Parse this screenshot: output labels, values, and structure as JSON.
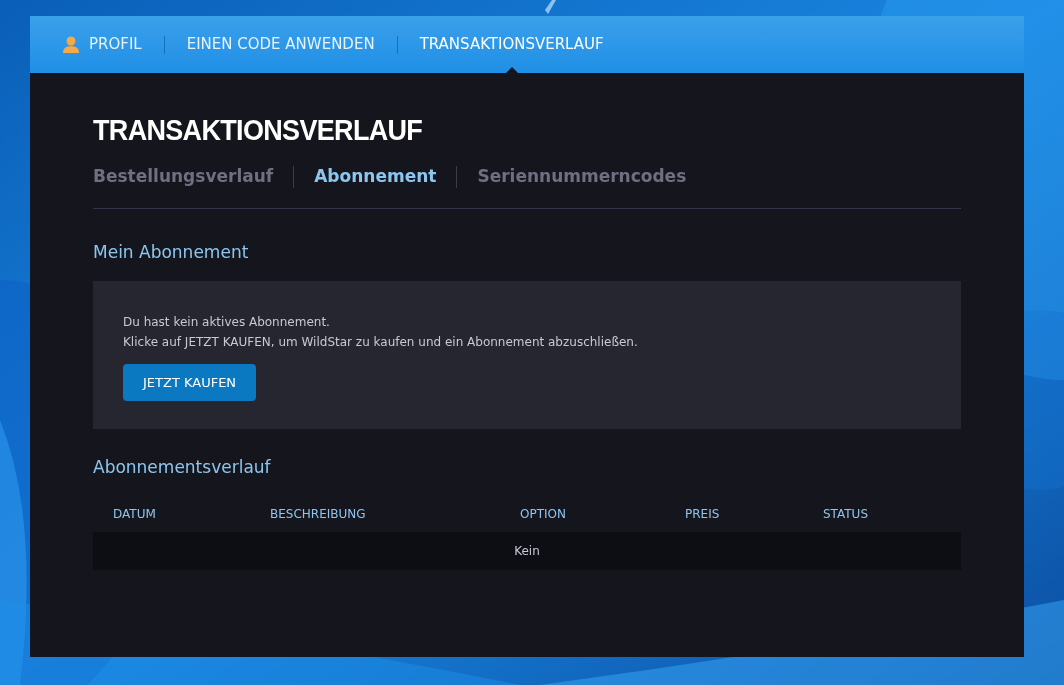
{
  "top_nav": [
    {
      "label": "PROFIL",
      "kind": "profile",
      "selected": false
    },
    {
      "label": "EINEN CODE ANWENDEN",
      "kind": "link",
      "selected": false
    },
    {
      "label": "TRANSAKTIONSVERLAUF",
      "kind": "link",
      "selected": true
    }
  ],
  "page_title": "TRANSAKTIONSVERLAUF",
  "tabs": [
    {
      "label": "Bestellungsverlauf",
      "selected": false
    },
    {
      "label": "Abonnement",
      "selected": true
    },
    {
      "label": "Seriennummerncodes",
      "selected": false
    }
  ],
  "subscription": {
    "heading": "Mein Abonnement",
    "lines": [
      "Du hast kein aktives Abonnement.",
      "Klicke auf JETZT KAUFEN, um WildStar zu kaufen und ein Abonnement abzuschließen."
    ],
    "button": "JETZT KAUFEN"
  },
  "history": {
    "heading": "Abonnementsverlauf",
    "columns": [
      "DATUM",
      "BESCHREIBUNG",
      "OPTION",
      "PREIS",
      "STATUS"
    ],
    "empty_text": "Kein"
  }
}
